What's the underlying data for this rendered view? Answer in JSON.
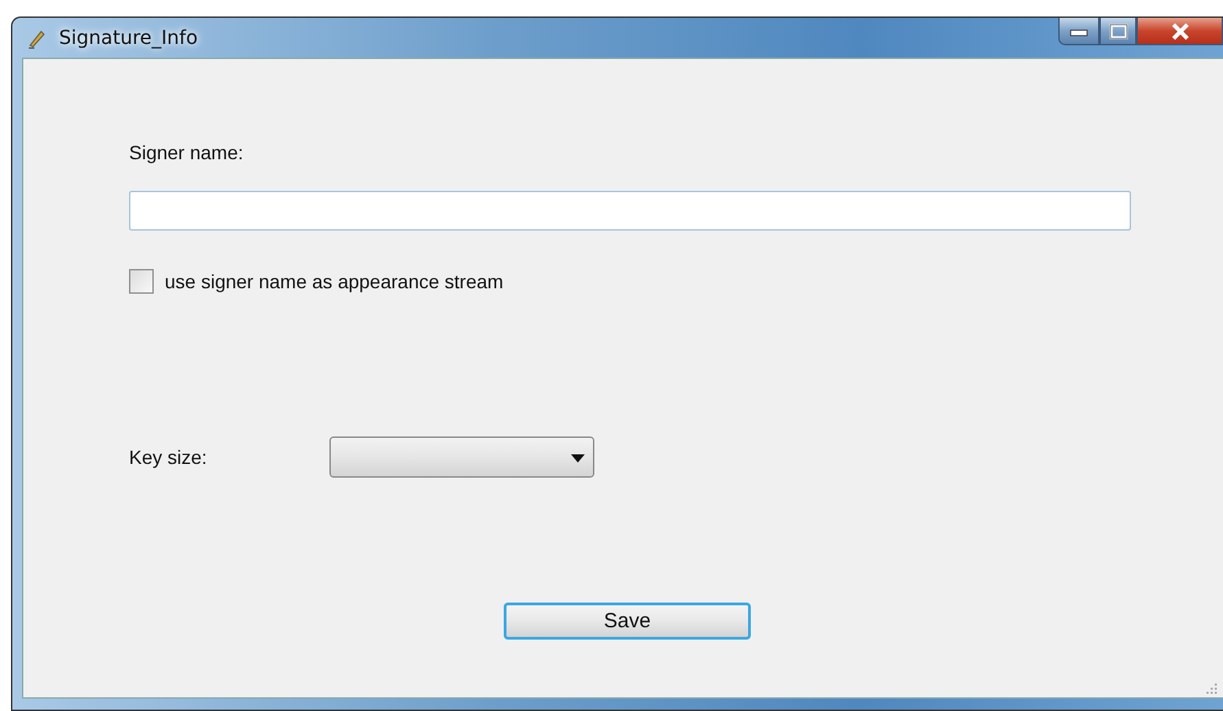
{
  "window": {
    "title": "Signature_Info"
  },
  "signer_name": {
    "label": "Signer name:"
  },
  "appearance_checkbox": {
    "label": "use signer name as appearance stream",
    "checked": false
  },
  "key_size": {
    "label": "Key size:"
  },
  "buttons": [
    {
      "label": "Save",
      "focused": true
    }
  ]
}
